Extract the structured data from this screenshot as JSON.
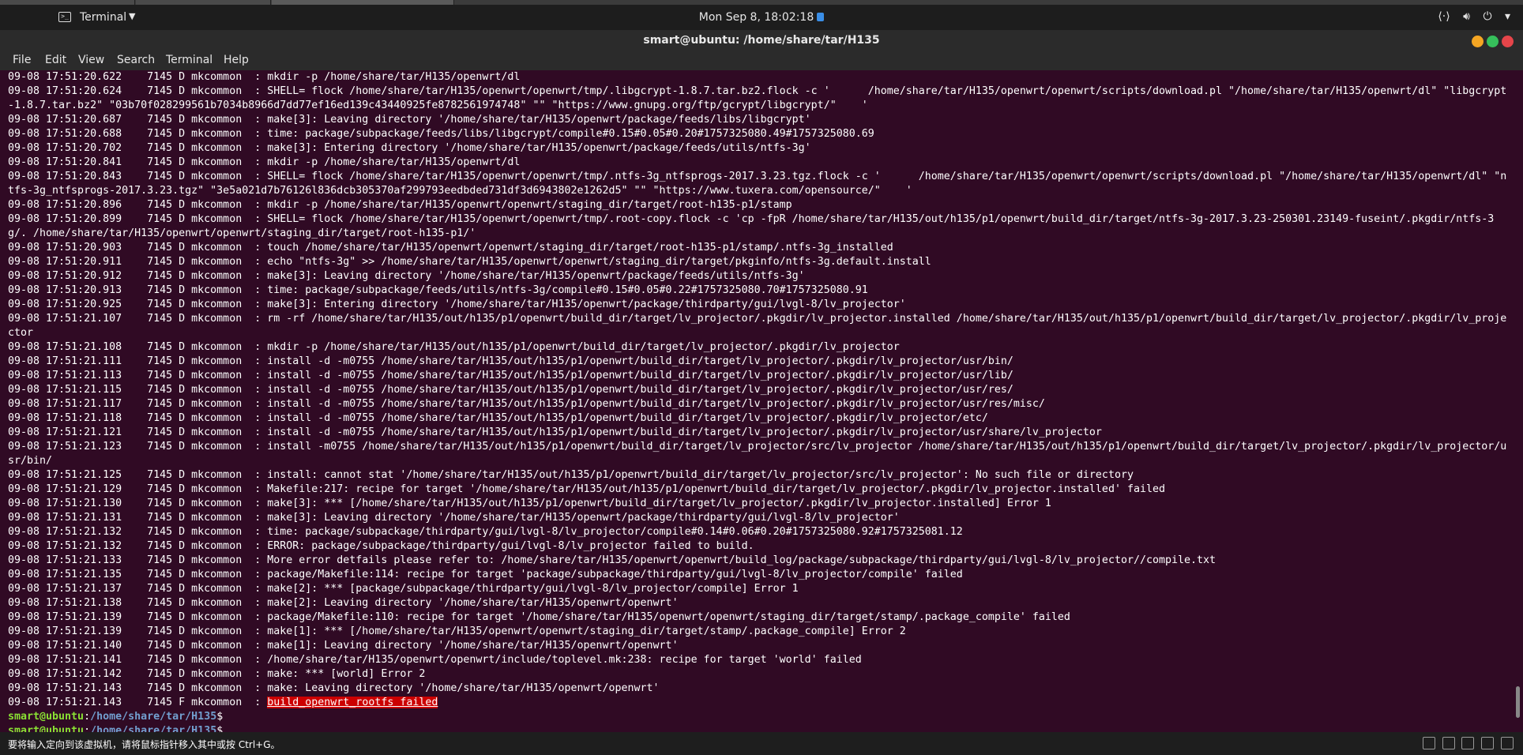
{
  "topbar": {
    "app_name": "Terminal",
    "clock": "Mon Sep  8, 18:02:18"
  },
  "window": {
    "title": "smart@ubuntu: /home/share/tar/H135"
  },
  "menu": [
    "File",
    "Edit",
    "View",
    "Search",
    "Terminal",
    "Help"
  ],
  "terminal": {
    "lines": [
      "09-08 17:51:20.622    7145 D mkcommon  : mkdir -p /home/share/tar/H135/openwrt/dl",
      "09-08 17:51:20.624    7145 D mkcommon  : SHELL= flock /home/share/tar/H135/openwrt/openwrt/tmp/.libgcrypt-1.8.7.tar.bz2.flock -c '      /home/share/tar/H135/openwrt/openwrt/scripts/download.pl \"/home/share/tar/H135/openwrt/dl\" \"libgcrypt-1.8.7.tar.bz2\" \"03b70f028299561b7034b8966d7dd77ef16ed139c43440925fe8782561974748\" \"\" \"https://www.gnupg.org/ftp/gcrypt/libgcrypt/\"    '",
      "09-08 17:51:20.687    7145 D mkcommon  : make[3]: Leaving directory '/home/share/tar/H135/openwrt/package/feeds/libs/libgcrypt'",
      "09-08 17:51:20.688    7145 D mkcommon  : time: package/subpackage/feeds/libs/libgcrypt/compile#0.15#0.05#0.20#1757325080.49#1757325080.69",
      "09-08 17:51:20.702    7145 D mkcommon  : make[3]: Entering directory '/home/share/tar/H135/openwrt/package/feeds/utils/ntfs-3g'",
      "09-08 17:51:20.841    7145 D mkcommon  : mkdir -p /home/share/tar/H135/openwrt/dl",
      "09-08 17:51:20.843    7145 D mkcommon  : SHELL= flock /home/share/tar/H135/openwrt/openwrt/tmp/.ntfs-3g_ntfsprogs-2017.3.23.tgz.flock -c '      /home/share/tar/H135/openwrt/openwrt/scripts/download.pl \"/home/share/tar/H135/openwrt/dl\" \"ntfs-3g_ntfsprogs-2017.3.23.tgz\" \"3e5a021d7b76126l836dcb305370af299793eedbded731df3d6943802e1262d5\" \"\" \"https://www.tuxera.com/opensource/\"    '",
      "09-08 17:51:20.896    7145 D mkcommon  : mkdir -p /home/share/tar/H135/openwrt/openwrt/staging_dir/target/root-h135-p1/stamp",
      "09-08 17:51:20.899    7145 D mkcommon  : SHELL= flock /home/share/tar/H135/openwrt/openwrt/tmp/.root-copy.flock -c 'cp -fpR /home/share/tar/H135/out/h135/p1/openwrt/build_dir/target/ntfs-3g-2017.3.23-250301.23149-fuseint/.pkgdir/ntfs-3g/. /home/share/tar/H135/openwrt/openwrt/staging_dir/target/root-h135-p1/'",
      "09-08 17:51:20.903    7145 D mkcommon  : touch /home/share/tar/H135/openwrt/openwrt/staging_dir/target/root-h135-p1/stamp/.ntfs-3g_installed",
      "09-08 17:51:20.911    7145 D mkcommon  : echo \"ntfs-3g\" >> /home/share/tar/H135/openwrt/openwrt/staging_dir/target/pkginfo/ntfs-3g.default.install",
      "09-08 17:51:20.912    7145 D mkcommon  : make[3]: Leaving directory '/home/share/tar/H135/openwrt/package/feeds/utils/ntfs-3g'",
      "09-08 17:51:20.913    7145 D mkcommon  : time: package/subpackage/feeds/utils/ntfs-3g/compile#0.15#0.05#0.22#1757325080.70#1757325080.91",
      "09-08 17:51:20.925    7145 D mkcommon  : make[3]: Entering directory '/home/share/tar/H135/openwrt/package/thirdparty/gui/lvgl-8/lv_projector'",
      "09-08 17:51:21.107    7145 D mkcommon  : rm -rf /home/share/tar/H135/out/h135/p1/openwrt/build_dir/target/lv_projector/.pkgdir/lv_projector.installed /home/share/tar/H135/out/h135/p1/openwrt/build_dir/target/lv_projector/.pkgdir/lv_projector",
      "09-08 17:51:21.108    7145 D mkcommon  : mkdir -p /home/share/tar/H135/out/h135/p1/openwrt/build_dir/target/lv_projector/.pkgdir/lv_projector",
      "09-08 17:51:21.111    7145 D mkcommon  : install -d -m0755 /home/share/tar/H135/out/h135/p1/openwrt/build_dir/target/lv_projector/.pkgdir/lv_projector/usr/bin/",
      "09-08 17:51:21.113    7145 D mkcommon  : install -d -m0755 /home/share/tar/H135/out/h135/p1/openwrt/build_dir/target/lv_projector/.pkgdir/lv_projector/usr/lib/",
      "09-08 17:51:21.115    7145 D mkcommon  : install -d -m0755 /home/share/tar/H135/out/h135/p1/openwrt/build_dir/target/lv_projector/.pkgdir/lv_projector/usr/res/",
      "09-08 17:51:21.117    7145 D mkcommon  : install -d -m0755 /home/share/tar/H135/out/h135/p1/openwrt/build_dir/target/lv_projector/.pkgdir/lv_projector/usr/res/misc/",
      "09-08 17:51:21.118    7145 D mkcommon  : install -d -m0755 /home/share/tar/H135/out/h135/p1/openwrt/build_dir/target/lv_projector/.pkgdir/lv_projector/etc/",
      "09-08 17:51:21.121    7145 D mkcommon  : install -d -m0755 /home/share/tar/H135/out/h135/p1/openwrt/build_dir/target/lv_projector/.pkgdir/lv_projector/usr/share/lv_projector",
      "09-08 17:51:21.123    7145 D mkcommon  : install -m0755 /home/share/tar/H135/out/h135/p1/openwrt/build_dir/target/lv_projector/src/lv_projector /home/share/tar/H135/out/h135/p1/openwrt/build_dir/target/lv_projector/.pkgdir/lv_projector/usr/bin/",
      "09-08 17:51:21.125    7145 D mkcommon  : install: cannot stat '/home/share/tar/H135/out/h135/p1/openwrt/build_dir/target/lv_projector/src/lv_projector': No such file or directory",
      "09-08 17:51:21.129    7145 D mkcommon  : Makefile:217: recipe for target '/home/share/tar/H135/out/h135/p1/openwrt/build_dir/target/lv_projector/.pkgdir/lv_projector.installed' failed",
      "09-08 17:51:21.130    7145 D mkcommon  : make[3]: *** [/home/share/tar/H135/out/h135/p1/openwrt/build_dir/target/lv_projector/.pkgdir/lv_projector.installed] Error 1",
      "09-08 17:51:21.131    7145 D mkcommon  : make[3]: Leaving directory '/home/share/tar/H135/openwrt/package/thirdparty/gui/lvgl-8/lv_projector'",
      "09-08 17:51:21.132    7145 D mkcommon  : time: package/subpackage/thirdparty/gui/lvgl-8/lv_projector/compile#0.14#0.06#0.20#1757325080.92#1757325081.12",
      "09-08 17:51:21.132    7145 D mkcommon  : ERROR: package/subpackage/thirdparty/gui/lvgl-8/lv_projector failed to build.",
      "09-08 17:51:21.133    7145 D mkcommon  : More error detfails please refer to: /home/share/tar/H135/openwrt/openwrt/build_log/package/subpackage/thirdparty/gui/lvgl-8/lv_projector//compile.txt",
      "09-08 17:51:21.135    7145 D mkcommon  : package/Makefile:114: recipe for target 'package/subpackage/thirdparty/gui/lvgl-8/lv_projector/compile' failed",
      "09-08 17:51:21.137    7145 D mkcommon  : make[2]: *** [package/subpackage/thirdparty/gui/lvgl-8/lv_projector/compile] Error 1",
      "09-08 17:51:21.138    7145 D mkcommon  : make[2]: Leaving directory '/home/share/tar/H135/openwrt/openwrt'",
      "09-08 17:51:21.139    7145 D mkcommon  : package/Makefile:110: recipe for target '/home/share/tar/H135/openwrt/openwrt/staging_dir/target/stamp/.package_compile' failed",
      "09-08 17:51:21.139    7145 D mkcommon  : make[1]: *** [/home/share/tar/H135/openwrt/openwrt/staging_dir/target/stamp/.package_compile] Error 2",
      "09-08 17:51:21.140    7145 D mkcommon  : make[1]: Leaving directory '/home/share/tar/H135/openwrt/openwrt'",
      "09-08 17:51:21.141    7145 D mkcommon  : /home/share/tar/H135/openwrt/openwrt/include/toplevel.mk:238: recipe for target 'world' failed",
      "09-08 17:51:21.142    7145 D mkcommon  : make: *** [world] Error 2",
      "09-08 17:51:21.143    7145 D mkcommon  : make: Leaving directory '/home/share/tar/H135/openwrt/openwrt'"
    ],
    "fatal_prefix": "09-08 17:51:21.143    7145 F mkcommon  : ",
    "fatal_message": "build_openwrt_rootfs failed",
    "prompts": [
      {
        "user": "smart@ubuntu",
        "sep": ":",
        "path": "/home/share/tar/H135",
        "symbol": "$"
      },
      {
        "user": "smart@ubuntu",
        "sep": ":",
        "path": "/home/share/tar/H135",
        "symbol": "$"
      }
    ]
  },
  "statusbar": {
    "message": "要将输入定向到该虚拟机，请将鼠标指针移入其中或按 Ctrl+G。"
  }
}
